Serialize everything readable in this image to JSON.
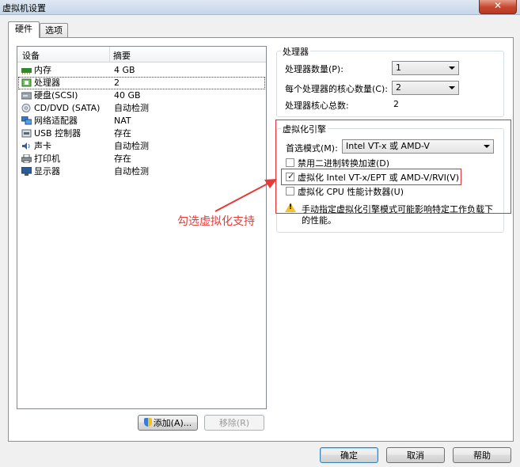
{
  "window": {
    "title": "虚拟机设置",
    "close_label": "✕"
  },
  "tabs": [
    {
      "label": "硬件"
    },
    {
      "label": "选项"
    }
  ],
  "device_list": {
    "headers": {
      "device": "设备",
      "summary": "摘要"
    },
    "rows": [
      {
        "name": "内存",
        "value": "4 GB",
        "icon": "memory-icon"
      },
      {
        "name": "处理器",
        "value": "2",
        "icon": "processor-icon",
        "selected": true
      },
      {
        "name": "硬盘(SCSI)",
        "value": "40 GB",
        "icon": "hard-disk-icon"
      },
      {
        "name": "CD/DVD (SATA)",
        "value": "自动检测",
        "icon": "cd-dvd-icon"
      },
      {
        "name": "网络适配器",
        "value": "NAT",
        "icon": "network-adapter-icon"
      },
      {
        "name": "USB 控制器",
        "value": "存在",
        "icon": "usb-icon"
      },
      {
        "name": "声卡",
        "value": "自动检测",
        "icon": "sound-card-icon"
      },
      {
        "name": "打印机",
        "value": "存在",
        "icon": "printer-icon"
      },
      {
        "name": "显示器",
        "value": "自动检测",
        "icon": "display-icon"
      }
    ]
  },
  "device_buttons": {
    "add": "添加(A)...",
    "remove": "移除(R)"
  },
  "processor": {
    "title": "处理器",
    "count_label": "处理器数量(P):",
    "count_value": "1",
    "cores_label": "每个处理器的核心数量(C):",
    "cores_value": "2",
    "total_label": "处理器核心总数:",
    "total_value": "2"
  },
  "virtualization": {
    "title": "虚拟化引擎",
    "mode_label": "首选模式(M):",
    "mode_value": "Intel VT-x 或 AMD-V",
    "options": [
      {
        "label": "禁用二进制转换加速(D)",
        "checked": false
      },
      {
        "label": "虚拟化 Intel VT-x/EPT 或 AMD-V/RVI(V)",
        "checked": true
      },
      {
        "label": "虚拟化 CPU 性能计数器(U)",
        "checked": false
      }
    ],
    "warning_line1": "手动指定虚拟化引擎模式可能影响特定工作负载下",
    "warning_line2": "的性能。"
  },
  "annotation": {
    "text": "勾选虚拟化支持",
    "color": "#e63a38"
  },
  "footer": {
    "ok": "确定",
    "cancel": "取消",
    "help": "帮助"
  }
}
